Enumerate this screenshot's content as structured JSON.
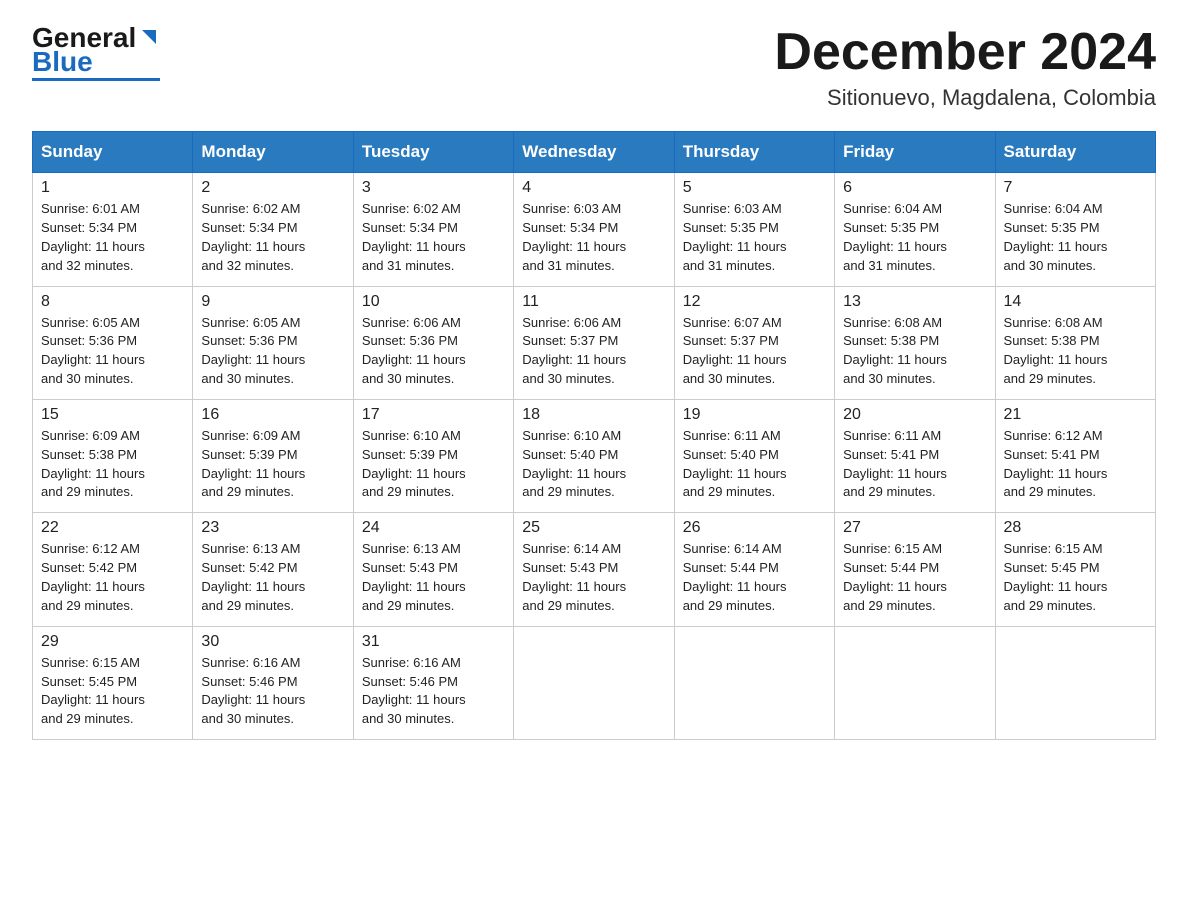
{
  "header": {
    "logo_general": "General",
    "logo_blue": "Blue",
    "month_title": "December 2024",
    "location": "Sitionuevo, Magdalena, Colombia"
  },
  "days_of_week": [
    "Sunday",
    "Monday",
    "Tuesday",
    "Wednesday",
    "Thursday",
    "Friday",
    "Saturday"
  ],
  "weeks": [
    [
      {
        "day": "1",
        "sunrise": "6:01 AM",
        "sunset": "5:34 PM",
        "daylight": "11 hours and 32 minutes."
      },
      {
        "day": "2",
        "sunrise": "6:02 AM",
        "sunset": "5:34 PM",
        "daylight": "11 hours and 32 minutes."
      },
      {
        "day": "3",
        "sunrise": "6:02 AM",
        "sunset": "5:34 PM",
        "daylight": "11 hours and 31 minutes."
      },
      {
        "day": "4",
        "sunrise": "6:03 AM",
        "sunset": "5:34 PM",
        "daylight": "11 hours and 31 minutes."
      },
      {
        "day": "5",
        "sunrise": "6:03 AM",
        "sunset": "5:35 PM",
        "daylight": "11 hours and 31 minutes."
      },
      {
        "day": "6",
        "sunrise": "6:04 AM",
        "sunset": "5:35 PM",
        "daylight": "11 hours and 31 minutes."
      },
      {
        "day": "7",
        "sunrise": "6:04 AM",
        "sunset": "5:35 PM",
        "daylight": "11 hours and 30 minutes."
      }
    ],
    [
      {
        "day": "8",
        "sunrise": "6:05 AM",
        "sunset": "5:36 PM",
        "daylight": "11 hours and 30 minutes."
      },
      {
        "day": "9",
        "sunrise": "6:05 AM",
        "sunset": "5:36 PM",
        "daylight": "11 hours and 30 minutes."
      },
      {
        "day": "10",
        "sunrise": "6:06 AM",
        "sunset": "5:36 PM",
        "daylight": "11 hours and 30 minutes."
      },
      {
        "day": "11",
        "sunrise": "6:06 AM",
        "sunset": "5:37 PM",
        "daylight": "11 hours and 30 minutes."
      },
      {
        "day": "12",
        "sunrise": "6:07 AM",
        "sunset": "5:37 PM",
        "daylight": "11 hours and 30 minutes."
      },
      {
        "day": "13",
        "sunrise": "6:08 AM",
        "sunset": "5:38 PM",
        "daylight": "11 hours and 30 minutes."
      },
      {
        "day": "14",
        "sunrise": "6:08 AM",
        "sunset": "5:38 PM",
        "daylight": "11 hours and 29 minutes."
      }
    ],
    [
      {
        "day": "15",
        "sunrise": "6:09 AM",
        "sunset": "5:38 PM",
        "daylight": "11 hours and 29 minutes."
      },
      {
        "day": "16",
        "sunrise": "6:09 AM",
        "sunset": "5:39 PM",
        "daylight": "11 hours and 29 minutes."
      },
      {
        "day": "17",
        "sunrise": "6:10 AM",
        "sunset": "5:39 PM",
        "daylight": "11 hours and 29 minutes."
      },
      {
        "day": "18",
        "sunrise": "6:10 AM",
        "sunset": "5:40 PM",
        "daylight": "11 hours and 29 minutes."
      },
      {
        "day": "19",
        "sunrise": "6:11 AM",
        "sunset": "5:40 PM",
        "daylight": "11 hours and 29 minutes."
      },
      {
        "day": "20",
        "sunrise": "6:11 AM",
        "sunset": "5:41 PM",
        "daylight": "11 hours and 29 minutes."
      },
      {
        "day": "21",
        "sunrise": "6:12 AM",
        "sunset": "5:41 PM",
        "daylight": "11 hours and 29 minutes."
      }
    ],
    [
      {
        "day": "22",
        "sunrise": "6:12 AM",
        "sunset": "5:42 PM",
        "daylight": "11 hours and 29 minutes."
      },
      {
        "day": "23",
        "sunrise": "6:13 AM",
        "sunset": "5:42 PM",
        "daylight": "11 hours and 29 minutes."
      },
      {
        "day": "24",
        "sunrise": "6:13 AM",
        "sunset": "5:43 PM",
        "daylight": "11 hours and 29 minutes."
      },
      {
        "day": "25",
        "sunrise": "6:14 AM",
        "sunset": "5:43 PM",
        "daylight": "11 hours and 29 minutes."
      },
      {
        "day": "26",
        "sunrise": "6:14 AM",
        "sunset": "5:44 PM",
        "daylight": "11 hours and 29 minutes."
      },
      {
        "day": "27",
        "sunrise": "6:15 AM",
        "sunset": "5:44 PM",
        "daylight": "11 hours and 29 minutes."
      },
      {
        "day": "28",
        "sunrise": "6:15 AM",
        "sunset": "5:45 PM",
        "daylight": "11 hours and 29 minutes."
      }
    ],
    [
      {
        "day": "29",
        "sunrise": "6:15 AM",
        "sunset": "5:45 PM",
        "daylight": "11 hours and 29 minutes."
      },
      {
        "day": "30",
        "sunrise": "6:16 AM",
        "sunset": "5:46 PM",
        "daylight": "11 hours and 30 minutes."
      },
      {
        "day": "31",
        "sunrise": "6:16 AM",
        "sunset": "5:46 PM",
        "daylight": "11 hours and 30 minutes."
      },
      null,
      null,
      null,
      null
    ]
  ],
  "labels": {
    "sunrise": "Sunrise:",
    "sunset": "Sunset:",
    "daylight": "Daylight:"
  }
}
